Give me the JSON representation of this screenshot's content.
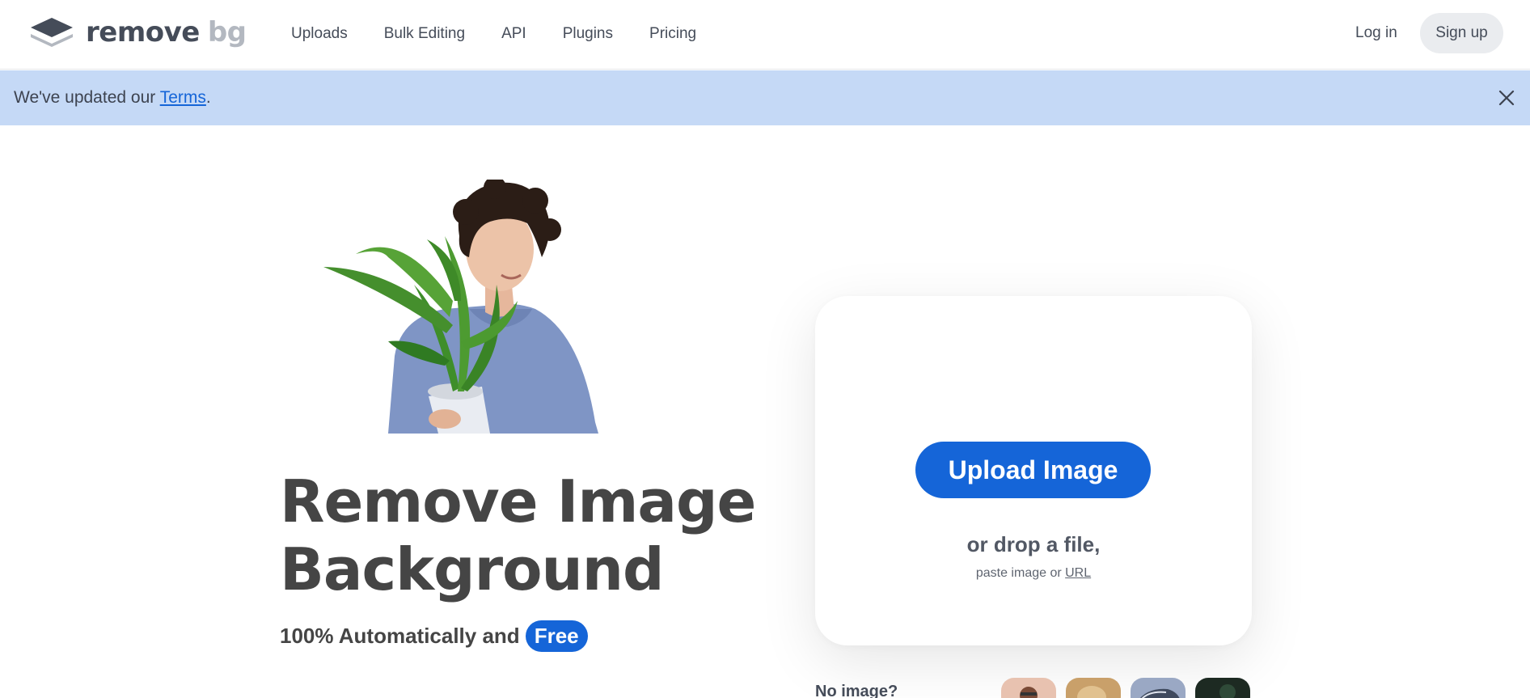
{
  "header": {
    "logo": {
      "word1": "remove",
      "word2": "bg",
      "icon": "layers-logo-icon"
    },
    "nav": [
      "Uploads",
      "Bulk Editing",
      "API",
      "Plugins",
      "Pricing"
    ],
    "login": "Log in",
    "signup": "Sign up"
  },
  "banner": {
    "text_before": "We've updated our ",
    "link": "Terms",
    "text_after": ".",
    "close_icon": "close-icon"
  },
  "hero": {
    "title_line1": "Remove Image",
    "title_line2": "Background",
    "subtitle": "100% Automatically and",
    "badge": "Free",
    "photo": "man-holding-plant-photo"
  },
  "upload": {
    "button": "Upload Image",
    "drop": "or drop a file,",
    "paste_before": "paste image or ",
    "paste_link": "URL"
  },
  "samples": {
    "label": "No image?",
    "thumbnails": [
      "sample-person",
      "sample-animal",
      "sample-car",
      "sample-product"
    ]
  },
  "colors": {
    "accent": "#1565d8",
    "banner_bg": "#c5d9f6",
    "text": "#454545",
    "signup_bg": "#eaecef"
  }
}
